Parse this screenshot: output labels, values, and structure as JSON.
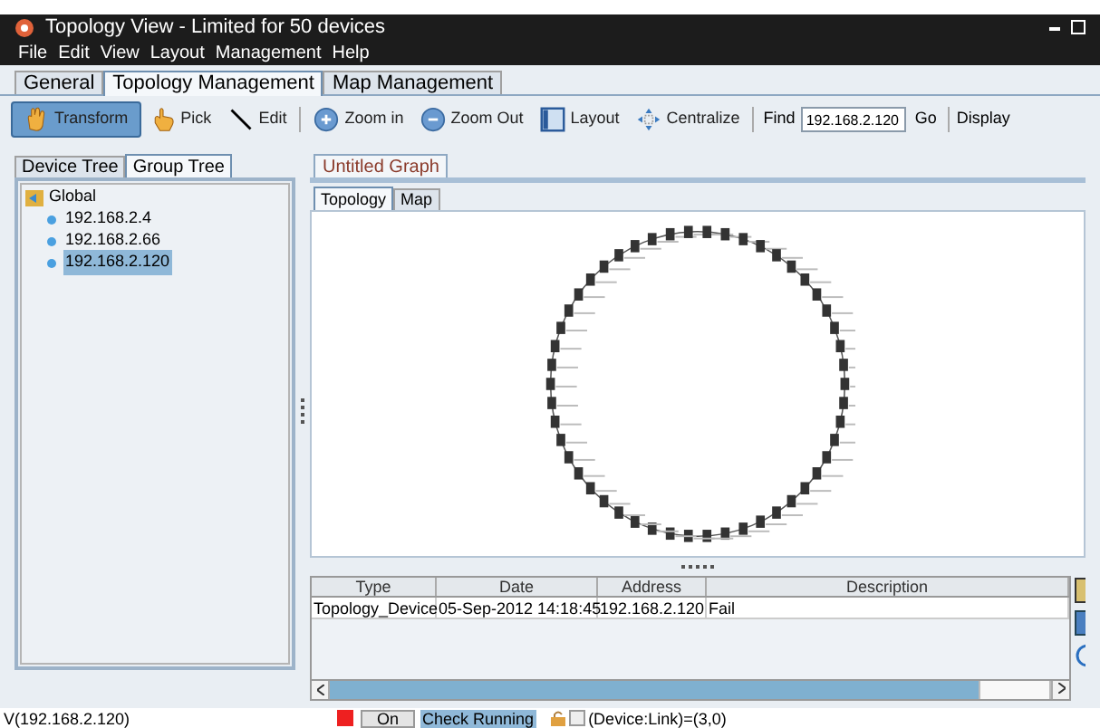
{
  "window": {
    "title": "Topology View - Limited for 50 devices"
  },
  "menu": [
    {
      "label": "File"
    },
    {
      "label": "Edit"
    },
    {
      "label": "View"
    },
    {
      "label": "Layout"
    },
    {
      "label": "Management"
    },
    {
      "label": "Help"
    }
  ],
  "main_tabs": [
    {
      "label": "General",
      "selected": false
    },
    {
      "label": "Topology Management",
      "selected": true
    },
    {
      "label": "Map Management",
      "selected": false
    }
  ],
  "toolbar": [
    {
      "kind": "hand",
      "label": "Transform",
      "selected": true
    },
    {
      "kind": "pointer",
      "label": "Pick",
      "selected": false
    },
    {
      "kind": "line",
      "label": "Edit",
      "selected": false
    },
    {
      "kind": "zoomin",
      "label": "Zoom in",
      "selected": false
    },
    {
      "kind": "zoomout",
      "label": "Zoom Out",
      "selected": false
    },
    {
      "kind": "layout",
      "label": "Layout",
      "selected": false
    },
    {
      "kind": "center",
      "label": "Centralize",
      "selected": false
    }
  ],
  "find": {
    "label": "Find",
    "value": "192.168.2.120",
    "go": "Go",
    "display": "Display"
  },
  "side_tabs": [
    {
      "label": "Device Tree",
      "selected": false
    },
    {
      "label": "Group Tree",
      "selected": true
    }
  ],
  "tree": {
    "label": "Global",
    "children": [
      {
        "label": "192.168.2.4",
        "selected": false
      },
      {
        "label": "192.168.2.66",
        "selected": false
      },
      {
        "label": "192.168.2.120",
        "selected": true
      }
    ]
  },
  "graph_tab": {
    "label": "Untitled Graph"
  },
  "view_tabs": [
    {
      "label": "Topology",
      "selected": true
    },
    {
      "label": "Map",
      "selected": false
    }
  ],
  "log_table": {
    "columns": [
      "Type",
      "Date",
      "Address",
      "Description"
    ],
    "rows": [
      [
        "Topology_Device",
        "05-Sep-2012 14:18:45",
        "192.168.2.120",
        "Fail"
      ]
    ]
  },
  "status_bar": {
    "vertex": "V(192.168.2.120)",
    "on_button": "On",
    "check_label": "Check Running",
    "count": "(Device:Link)=(3,0)",
    "lock_checked": false
  }
}
